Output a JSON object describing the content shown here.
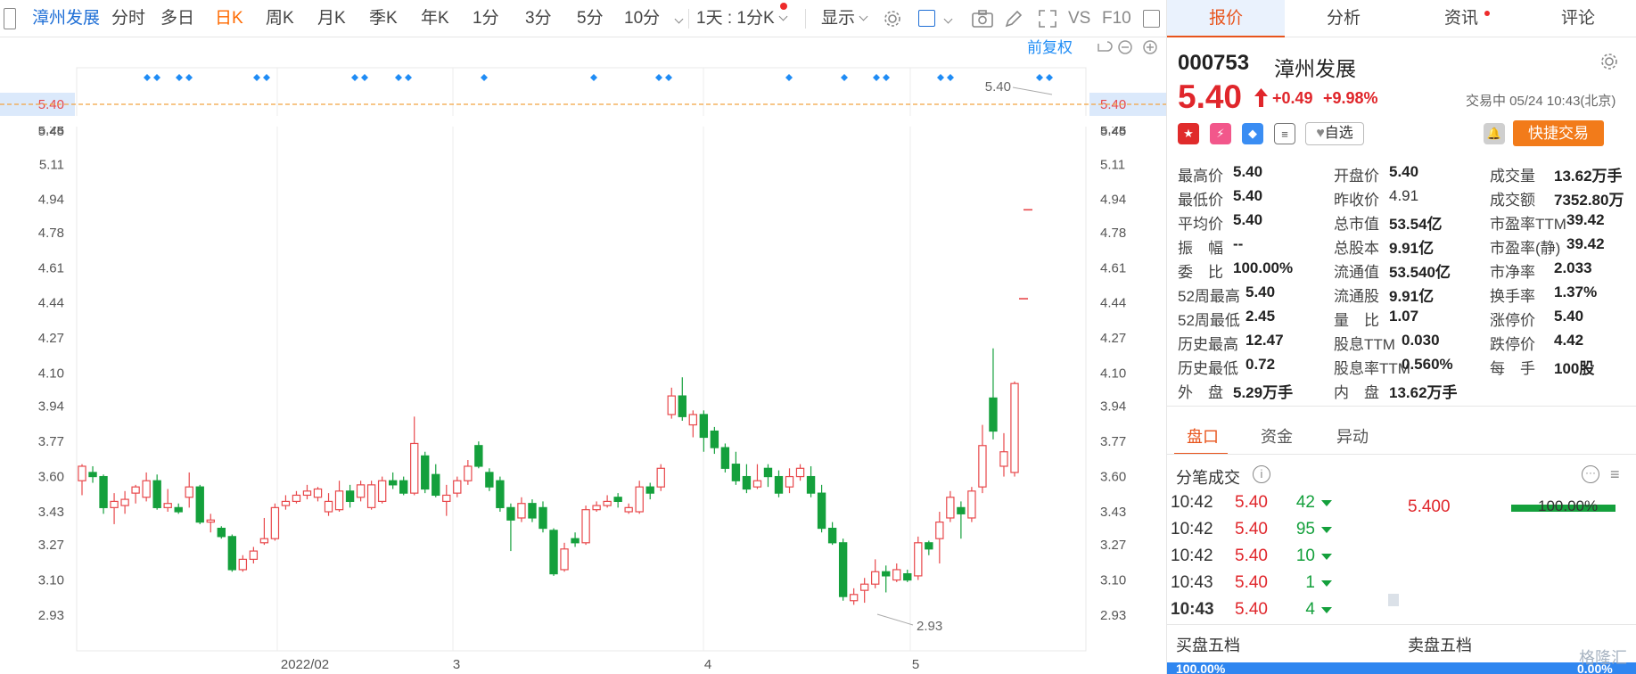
{
  "toolbar": {
    "stock_name": "漳州发展",
    "items": [
      "分时",
      "多日",
      "日K",
      "周K",
      "月K",
      "季K",
      "年K",
      "1分",
      "3分",
      "5分",
      "10分"
    ],
    "interval": "1天 : 1分K",
    "display": "显示",
    "vs": "VS",
    "f10": "F10"
  },
  "chart": {
    "adjust_label": "前复权",
    "price_labels": [
      "5.40",
      "5.28",
      "5.11",
      "4.94",
      "4.78",
      "4.61",
      "4.44",
      "4.27",
      "4.10",
      "3.94",
      "3.77",
      "3.60",
      "3.43",
      "3.27",
      "3.10",
      "2.93"
    ],
    "current_price": "5.40",
    "top_partial": "5.45",
    "date_labels": [
      "2022/02",
      "3",
      "4",
      "5"
    ],
    "high_marker": "5.40",
    "low_marker": "2.93",
    "colors": {
      "up": "#e8484b",
      "down": "#14a03c",
      "dash": "#f2a340",
      "accent": "#1f8cf5"
    }
  },
  "quote": {
    "tabs": [
      "报价",
      "分析",
      "资讯",
      "评论"
    ],
    "code": "000753",
    "name": "漳州发展",
    "price": "5.40",
    "change": "+0.49",
    "change_pct": "+9.98%",
    "status": "交易中 05/24 10:43(北京)",
    "watch_label": "自选",
    "trade_button": "快捷交易",
    "fields": [
      [
        {
          "l": "最高价",
          "v": "5.40",
          "c": "red"
        },
        {
          "l": "开盘价",
          "v": "5.40",
          "c": "red"
        },
        {
          "l": "成交量",
          "v": "13.62万手",
          "c": ""
        }
      ],
      [
        {
          "l": "最低价",
          "v": "5.40",
          "c": "red"
        },
        {
          "l": "昨收价",
          "v": "4.91",
          "c": "plain"
        },
        {
          "l": "成交额",
          "v": "7352.80万",
          "c": ""
        }
      ],
      [
        {
          "l": "平均价",
          "v": "5.40",
          "c": "red"
        },
        {
          "l": "总市值",
          "v": "53.54亿",
          "c": ""
        },
        {
          "l": "市盈率TTM",
          "v": "39.42",
          "c": ""
        }
      ],
      [
        {
          "l": "振　幅",
          "v": "--",
          "c": ""
        },
        {
          "l": "总股本",
          "v": "9.91亿",
          "c": ""
        },
        {
          "l": "市盈率(静)",
          "v": "39.42",
          "c": ""
        }
      ],
      [
        {
          "l": "委　比",
          "v": "100.00%",
          "c": ""
        },
        {
          "l": "流通值",
          "v": "53.540亿",
          "c": ""
        },
        {
          "l": "市净率",
          "v": "2.033",
          "c": ""
        }
      ],
      [
        {
          "l": "52周最高",
          "v": "5.40",
          "c": "red"
        },
        {
          "l": "流通股",
          "v": "9.91亿",
          "c": ""
        },
        {
          "l": "换手率",
          "v": "1.37%",
          "c": ""
        }
      ],
      [
        {
          "l": "52周最低",
          "v": "2.45",
          "c": "green"
        },
        {
          "l": "量　比",
          "v": "1.07",
          "c": ""
        },
        {
          "l": "涨停价",
          "v": "5.40",
          "c": "red"
        }
      ],
      [
        {
          "l": "历史最高",
          "v": "12.47",
          "c": "red"
        },
        {
          "l": "股息TTM",
          "v": "0.030",
          "c": ""
        },
        {
          "l": "跌停价",
          "v": "4.42",
          "c": "green"
        }
      ],
      [
        {
          "l": "历史最低",
          "v": "0.72",
          "c": "green"
        },
        {
          "l": "股息率TTM",
          "v": "0.560%",
          "c": ""
        },
        {
          "l": "每　手",
          "v": "100股",
          "c": ""
        }
      ],
      [
        {
          "l": "外　盘",
          "v": "5.29万手",
          "c": "red"
        },
        {
          "l": "内　盘",
          "v": "13.62万手",
          "c": "green"
        },
        {
          "l": "",
          "v": "",
          "c": ""
        }
      ]
    ],
    "subtabs": [
      "盘口",
      "资金",
      "异动"
    ],
    "ticks_title": "分笔成交",
    "ticks": [
      {
        "t": "10:42",
        "p": "5.40",
        "v": "42"
      },
      {
        "t": "10:42",
        "p": "5.40",
        "v": "95"
      },
      {
        "t": "10:42",
        "p": "5.40",
        "v": "10"
      },
      {
        "t": "10:43",
        "p": "5.40",
        "v": "1"
      },
      {
        "t": "10:43",
        "p": "5.40",
        "v": "4"
      }
    ],
    "dist_price": "5.400",
    "dist_pct": "100.00%",
    "buy_title": "买盘五档",
    "sell_title": "卖盘五档",
    "buy_pct": "100.00%",
    "sell_pct": "0.00%",
    "watermark": "格隆汇"
  },
  "candles": [
    [
      3.58,
      3.65,
      3.66,
      3.51,
      1
    ],
    [
      3.62,
      3.6,
      3.65,
      3.57,
      0
    ],
    [
      3.6,
      3.45,
      3.61,
      3.42,
      0
    ],
    [
      3.45,
      3.48,
      3.52,
      3.37,
      1
    ],
    [
      3.46,
      3.49,
      3.53,
      3.42,
      1
    ],
    [
      3.52,
      3.55,
      3.56,
      3.47,
      1
    ],
    [
      3.5,
      3.58,
      3.62,
      3.48,
      1
    ],
    [
      3.58,
      3.45,
      3.61,
      3.44,
      0
    ],
    [
      3.45,
      3.47,
      3.54,
      3.43,
      1
    ],
    [
      3.45,
      3.43,
      3.47,
      3.42,
      0
    ],
    [
      3.5,
      3.55,
      3.62,
      3.45,
      1
    ],
    [
      3.55,
      3.38,
      3.56,
      3.37,
      0
    ],
    [
      3.38,
      3.39,
      3.42,
      3.33,
      1
    ],
    [
      3.35,
      3.31,
      3.36,
      3.3,
      0
    ],
    [
      3.31,
      3.15,
      3.32,
      3.14,
      0
    ],
    [
      3.15,
      3.2,
      3.22,
      3.14,
      1
    ],
    [
      3.2,
      3.24,
      3.26,
      3.18,
      1
    ],
    [
      3.28,
      3.3,
      3.4,
      3.27,
      1
    ],
    [
      3.3,
      3.45,
      3.47,
      3.29,
      1
    ],
    [
      3.46,
      3.48,
      3.51,
      3.44,
      1
    ],
    [
      3.48,
      3.51,
      3.53,
      3.47,
      1
    ],
    [
      3.51,
      3.53,
      3.56,
      3.49,
      1
    ],
    [
      3.5,
      3.54,
      3.55,
      3.48,
      1
    ],
    [
      3.48,
      3.43,
      3.52,
      3.41,
      1
    ],
    [
      3.44,
      3.53,
      3.58,
      3.43,
      1
    ],
    [
      3.53,
      3.48,
      3.56,
      3.45,
      0
    ],
    [
      3.5,
      3.56,
      3.58,
      3.48,
      1
    ],
    [
      3.56,
      3.45,
      3.58,
      3.44,
      1
    ],
    [
      3.48,
      3.58,
      3.6,
      3.47,
      1
    ],
    [
      3.58,
      3.56,
      3.62,
      3.54,
      0
    ],
    [
      3.58,
      3.52,
      3.6,
      3.51,
      0
    ],
    [
      3.52,
      3.76,
      3.89,
      3.51,
      1
    ],
    [
      3.7,
      3.54,
      3.72,
      3.52,
      0
    ],
    [
      3.61,
      3.51,
      3.66,
      3.5,
      0
    ],
    [
      3.51,
      3.48,
      3.56,
      3.41,
      1
    ],
    [
      3.52,
      3.58,
      3.6,
      3.5,
      1
    ],
    [
      3.58,
      3.65,
      3.68,
      3.56,
      1
    ],
    [
      3.75,
      3.65,
      3.77,
      3.64,
      0
    ],
    [
      3.62,
      3.55,
      3.64,
      3.53,
      0
    ],
    [
      3.58,
      3.45,
      3.6,
      3.43,
      0
    ],
    [
      3.45,
      3.39,
      3.47,
      3.24,
      0
    ],
    [
      3.4,
      3.47,
      3.5,
      3.38,
      1
    ],
    [
      3.47,
      3.4,
      3.49,
      3.38,
      0
    ],
    [
      3.45,
      3.35,
      3.48,
      3.33,
      0
    ],
    [
      3.34,
      3.13,
      3.35,
      3.12,
      0
    ],
    [
      3.15,
      3.25,
      3.28,
      3.14,
      1
    ],
    [
      3.3,
      3.28,
      3.33,
      3.26,
      0
    ],
    [
      3.28,
      3.44,
      3.46,
      3.27,
      1
    ],
    [
      3.44,
      3.46,
      3.48,
      3.43,
      1
    ],
    [
      3.46,
      3.48,
      3.51,
      3.45,
      1
    ],
    [
      3.5,
      3.48,
      3.52,
      3.45,
      0
    ],
    [
      3.43,
      3.45,
      3.47,
      3.42,
      1
    ],
    [
      3.43,
      3.55,
      3.58,
      3.42,
      1
    ],
    [
      3.55,
      3.52,
      3.57,
      3.49,
      0
    ],
    [
      3.55,
      3.64,
      3.66,
      3.53,
      1
    ],
    [
      3.9,
      3.99,
      4.03,
      3.88,
      1
    ],
    [
      3.99,
      3.89,
      4.08,
      3.87,
      0
    ],
    [
      3.85,
      3.9,
      3.92,
      3.79,
      1
    ],
    [
      3.9,
      3.79,
      3.92,
      3.72,
      0
    ],
    [
      3.82,
      3.74,
      3.84,
      3.71,
      0
    ],
    [
      3.74,
      3.64,
      3.76,
      3.62,
      0
    ],
    [
      3.66,
      3.58,
      3.72,
      3.56,
      0
    ],
    [
      3.6,
      3.54,
      3.66,
      3.52,
      0
    ],
    [
      3.55,
      3.58,
      3.66,
      3.54,
      1
    ],
    [
      3.64,
      3.6,
      3.66,
      3.55,
      0
    ],
    [
      3.6,
      3.52,
      3.63,
      3.5,
      0
    ],
    [
      3.55,
      3.6,
      3.64,
      3.52,
      1
    ],
    [
      3.6,
      3.64,
      3.66,
      3.58,
      1
    ],
    [
      3.6,
      3.52,
      3.65,
      3.5,
      0
    ],
    [
      3.52,
      3.35,
      3.56,
      3.33,
      0
    ],
    [
      3.35,
      3.28,
      3.38,
      3.27,
      0
    ],
    [
      3.28,
      3.02,
      3.3,
      3.0,
      0
    ],
    [
      3.0,
      3.03,
      3.06,
      2.98,
      1
    ],
    [
      3.05,
      3.08,
      3.11,
      2.99,
      1
    ],
    [
      3.08,
      3.14,
      3.2,
      3.06,
      1
    ],
    [
      3.14,
      3.12,
      3.17,
      3.04,
      0
    ],
    [
      3.1,
      3.15,
      3.18,
      3.09,
      1
    ],
    [
      3.13,
      3.1,
      3.15,
      3.09,
      0
    ],
    [
      3.12,
      3.28,
      3.31,
      3.1,
      1
    ],
    [
      3.28,
      3.25,
      3.29,
      3.22,
      0
    ],
    [
      3.3,
      3.38,
      3.43,
      3.18,
      1
    ],
    [
      3.4,
      3.5,
      3.53,
      3.38,
      1
    ],
    [
      3.45,
      3.42,
      3.48,
      3.3,
      0
    ],
    [
      3.4,
      3.53,
      3.55,
      3.38,
      1
    ],
    [
      3.55,
      3.75,
      3.85,
      3.52,
      1
    ],
    [
      3.98,
      3.82,
      4.22,
      3.78,
      0
    ],
    [
      3.65,
      3.72,
      3.81,
      3.6,
      1
    ],
    [
      3.62,
      4.05,
      4.06,
      3.6,
      1
    ]
  ]
}
